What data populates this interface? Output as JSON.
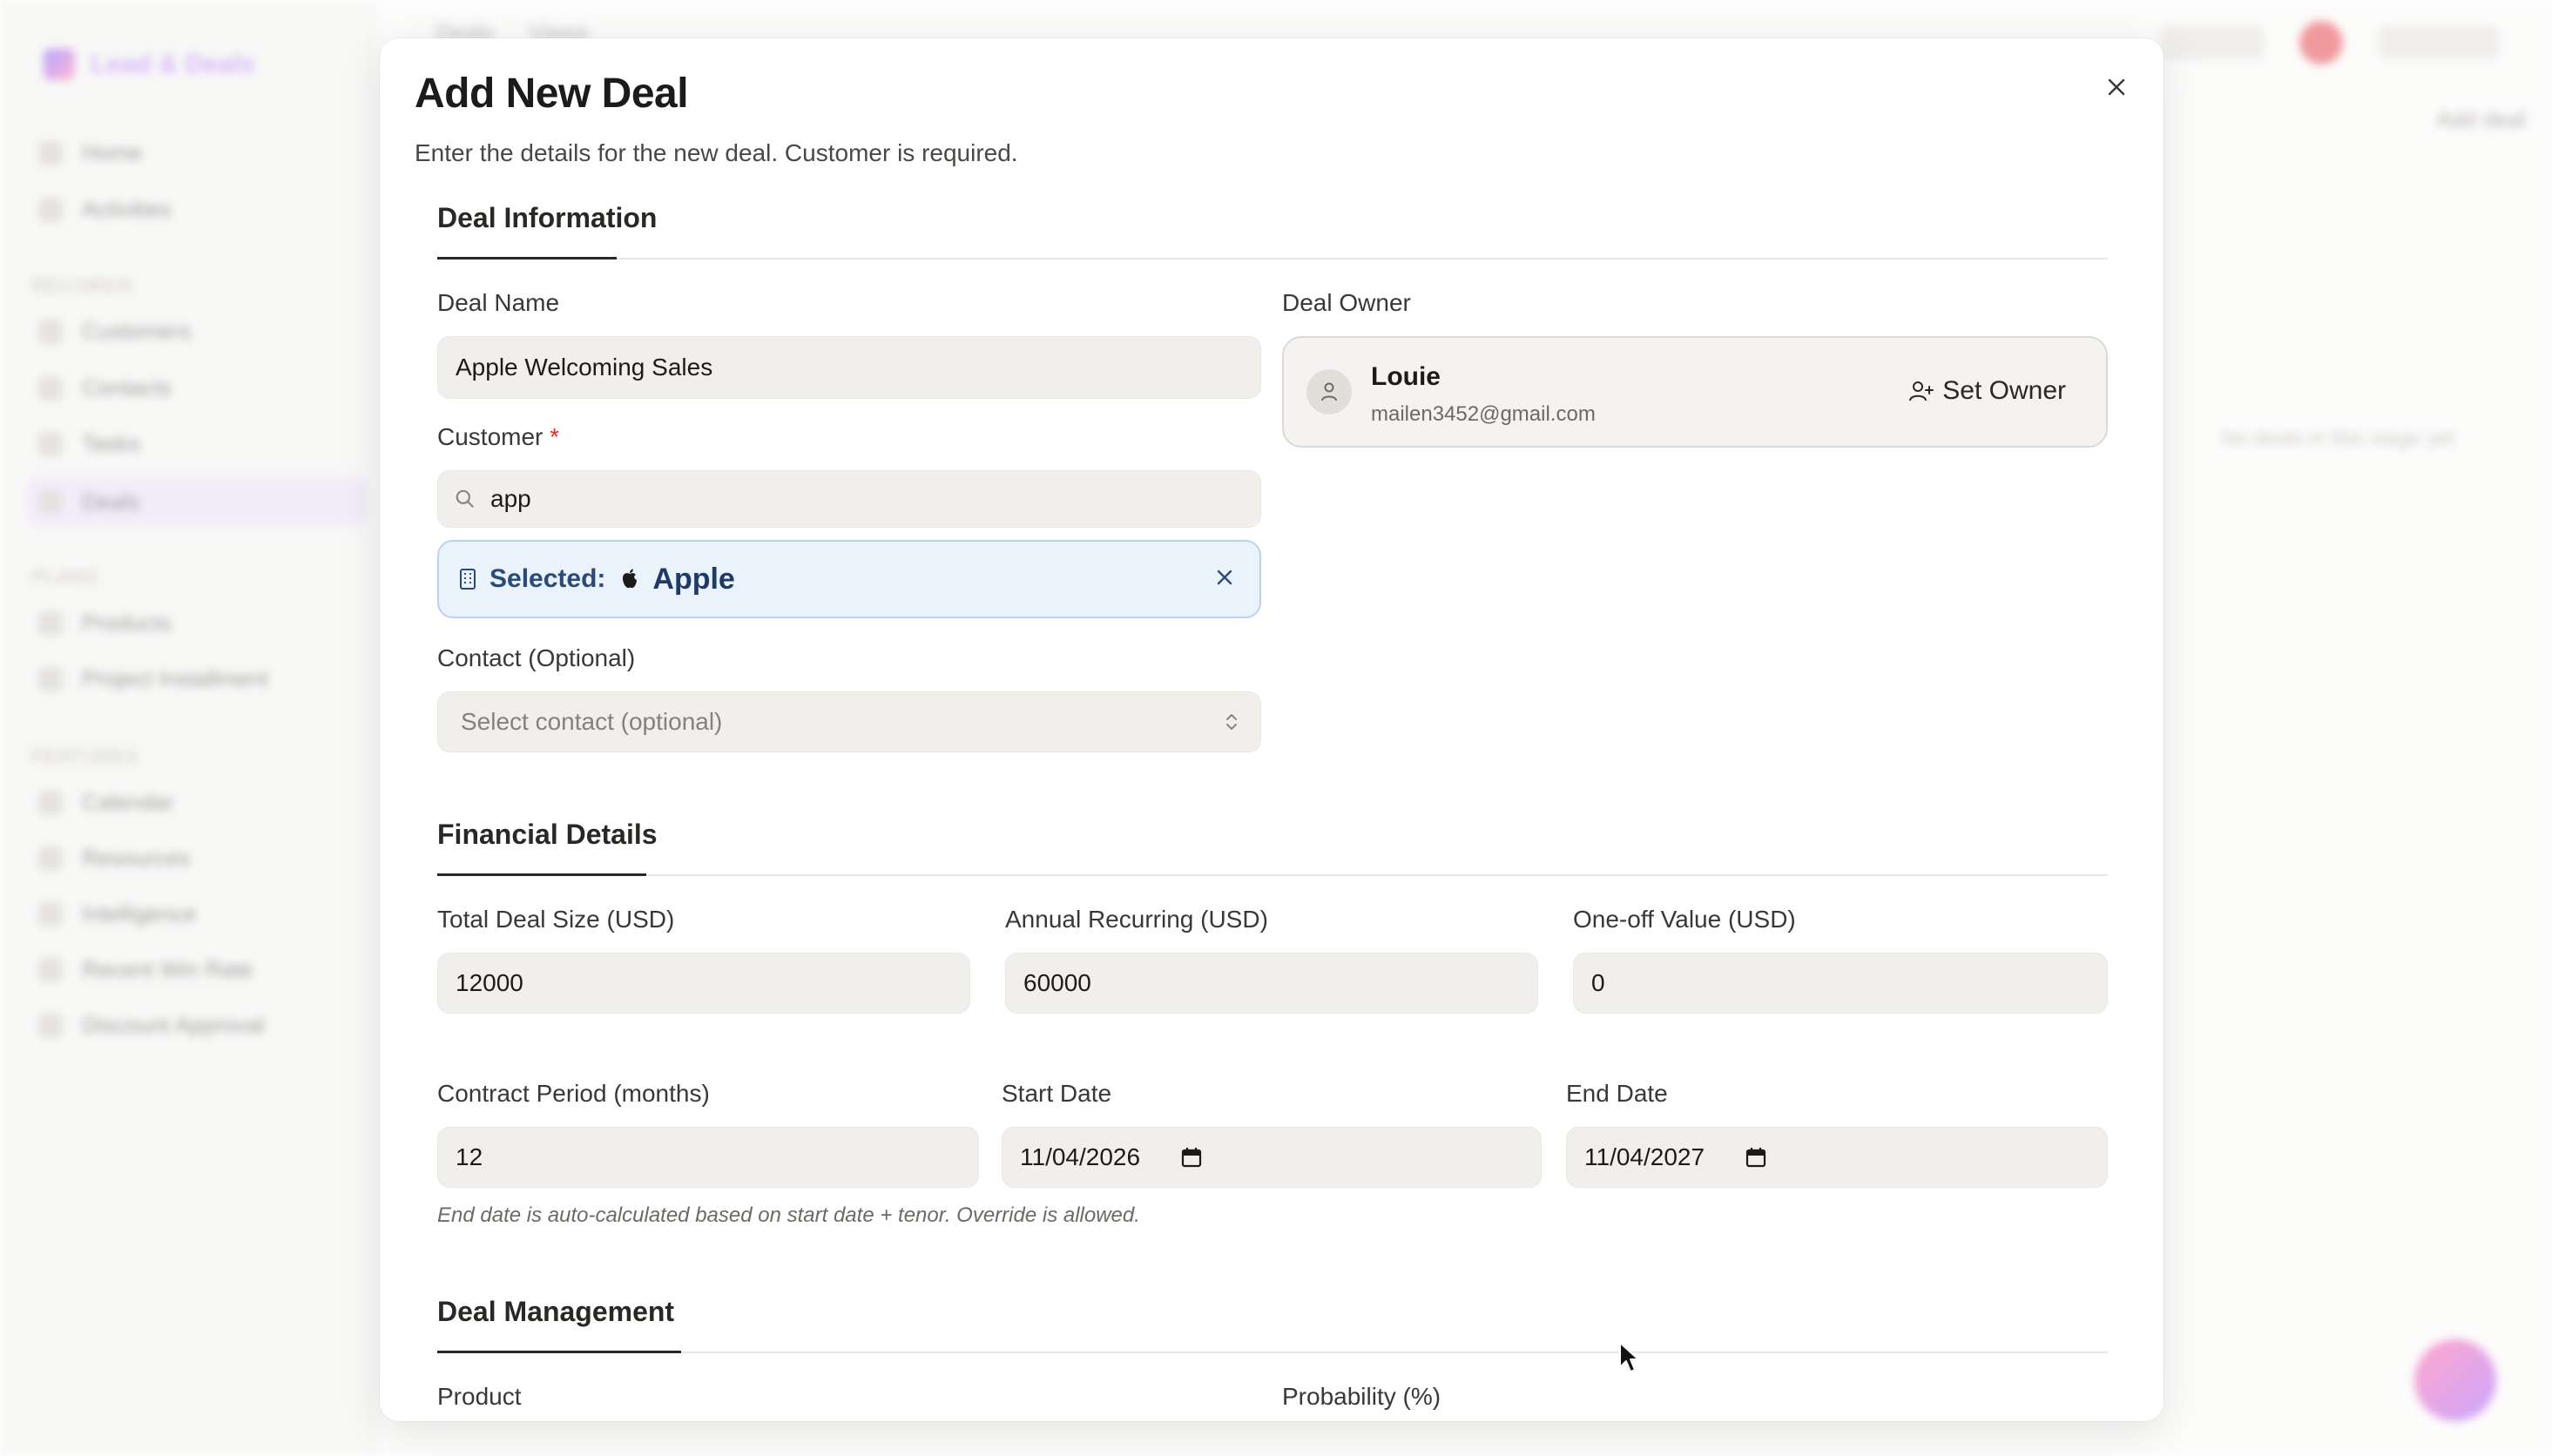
{
  "background": {
    "app_name": "Lead & Deals",
    "nav": [
      "Home",
      "Activities",
      "Customers",
      "Contacts",
      "Tasks",
      "Deals",
      "Products",
      "Project Installment",
      "Calendar",
      "Resources",
      "Intelligence",
      "Recent Win Rate",
      "Discount Approval"
    ],
    "sections": [
      "RECORDS",
      "PLANS",
      "FEATURES"
    ],
    "topbar": [
      "Deals",
      "Views"
    ],
    "right_panel_text": "No deals in this stage yet",
    "right_button": "Add deal"
  },
  "modal": {
    "title": "Add New Deal",
    "subtitle": "Enter the details for the new deal. Customer is required.",
    "close_icon": "close-icon",
    "deal_info": {
      "heading": "Deal Information",
      "deal_name_label": "Deal Name",
      "deal_name_value": "Apple Welcoming Sales",
      "customer_label": "Customer",
      "required_mark": "*",
      "customer_search_value": "app",
      "selected_label": "Selected:",
      "selected_value": "Apple",
      "contact_label": "Contact (Optional)",
      "contact_placeholder": "Select contact (optional)",
      "owner_label": "Deal Owner",
      "owner_name": "Louie",
      "owner_email": "mailen3452@gmail.com",
      "set_owner_label": "Set Owner"
    },
    "financial": {
      "heading": "Financial Details",
      "total_label": "Total Deal Size (USD)",
      "total_value": "12000",
      "arr_label": "Annual Recurring (USD)",
      "arr_value": "60000",
      "oneoff_label": "One-off Value (USD)",
      "oneoff_value": "0",
      "period_label": "Contract Period (months)",
      "period_value": "12",
      "start_label": "Start Date",
      "start_value": "11/04/2026",
      "end_label": "End Date",
      "end_value": "11/04/2027",
      "hint": "End date is auto-calculated based on start date + tenor. Override is allowed."
    },
    "management": {
      "heading": "Deal Management",
      "product_label": "Product",
      "probability_label": "Probability (%)"
    }
  },
  "colors": {
    "accent_blue": "#1f3a68",
    "selected_bg": "#eaf2fb",
    "required": "#d93025"
  }
}
